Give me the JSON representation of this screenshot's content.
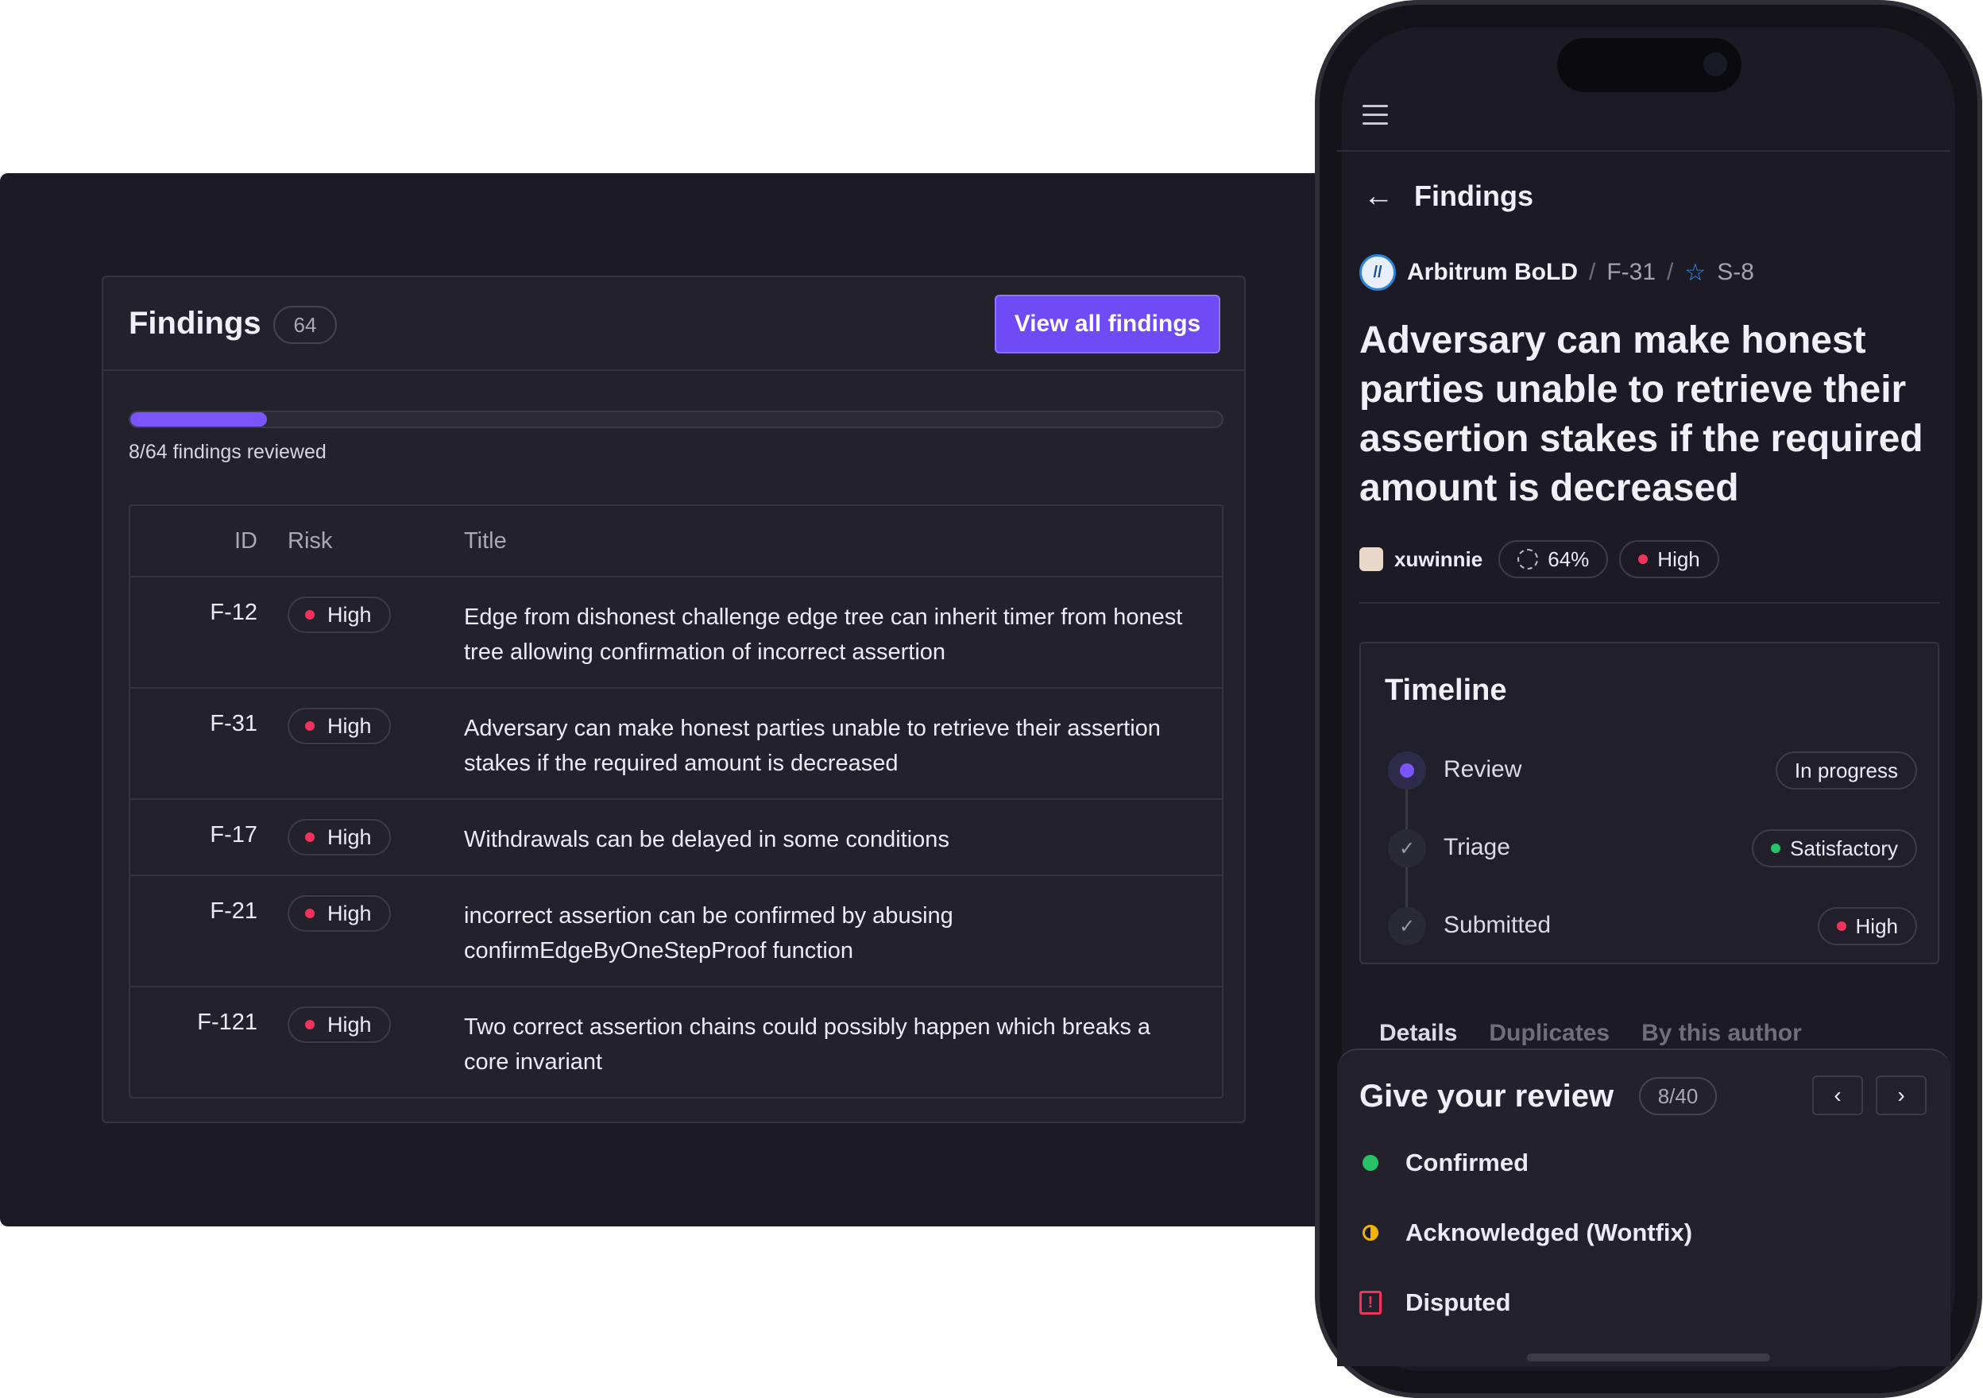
{
  "desktop": {
    "title": "Findings",
    "count": "64",
    "view_all": "View all findings",
    "progress": {
      "reviewed": 8,
      "total": 64,
      "fraction": 0.125,
      "label": "8/64 findings reviewed"
    },
    "table": {
      "columns": [
        "ID",
        "Risk",
        "Title"
      ],
      "rows": [
        {
          "id": "F-12",
          "risk": "High",
          "title": "Edge from dishonest challenge edge tree can inherit timer from honest tree allowing confirmation of incorrect assertion"
        },
        {
          "id": "F-31",
          "risk": "High",
          "title": "Adversary can make honest parties unable to retrieve their assertion stakes if the required amount is decreased"
        },
        {
          "id": "F-17",
          "risk": "High",
          "title": "Withdrawals can be delayed in some conditions"
        },
        {
          "id": "F-21",
          "risk": "High",
          "title": "incorrect assertion can be confirmed by abusing confirmEdgeByOneStepProof function"
        },
        {
          "id": "F-121",
          "risk": "High",
          "title": "Two correct assertion chains could possibly happen which breaks a core invariant"
        }
      ]
    }
  },
  "phone": {
    "header": {
      "back_label": "Findings"
    },
    "breadcrumb": {
      "project": "Arbitrum BoLD",
      "finding": "F-31",
      "submission": "S-8"
    },
    "title": "Adversary can make honest parties unable to retrieve their assertion stakes if the required amount is decreased",
    "meta": {
      "author": "xuwinnie",
      "score": "64%",
      "risk": "High"
    },
    "timeline": {
      "title": "Timeline",
      "items": [
        {
          "label": "Review",
          "badge": "In progress"
        },
        {
          "label": "Triage",
          "badge": "Satisfactory"
        },
        {
          "label": "Submitted",
          "badge": "High"
        }
      ]
    },
    "tabs": [
      "Details",
      "Duplicates",
      "By this author"
    ],
    "review": {
      "title": "Give your review",
      "count": "8/40",
      "options": [
        "Confirmed",
        "Acknowledged (Wontfix)",
        "Disputed"
      ]
    }
  },
  "colors": {
    "accent": "#6e4bf5",
    "high_risk": "#f0345e",
    "satisfactory": "#25c26a",
    "acknowledged": "#f0b400"
  }
}
